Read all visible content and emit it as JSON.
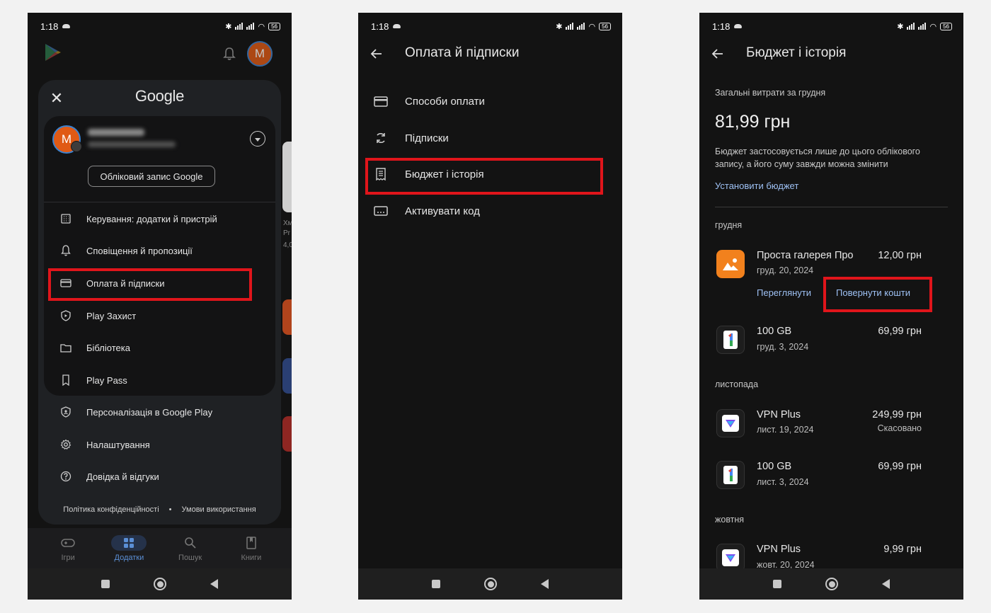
{
  "status": {
    "time": "1:18",
    "battery": "56"
  },
  "screen1": {
    "brand": "Google",
    "account_button": "Обліковий запис Google",
    "avatar_letter": "M",
    "menu": [
      {
        "label": "Керування: додатки й пристрій",
        "icon": "grid-icon"
      },
      {
        "label": "Сповіщення й пропозиції",
        "icon": "bell-icon"
      },
      {
        "label": "Оплата й підписки",
        "icon": "card-icon"
      },
      {
        "label": "Play Захист",
        "icon": "shield-icon"
      },
      {
        "label": "Бібліотека",
        "icon": "folder-icon"
      },
      {
        "label": "Play Pass",
        "icon": "bookmark-icon"
      },
      {
        "label": "Персоналізація в Google Play",
        "icon": "personalize-icon"
      },
      {
        "label": "Налаштування",
        "icon": "gear-icon"
      },
      {
        "label": "Довідка й відгуки",
        "icon": "help-icon"
      }
    ],
    "footer": {
      "privacy": "Політика конфіденційності",
      "dot": "•",
      "terms": "Умови використання"
    },
    "bottom_nav": [
      {
        "label": "Ігри",
        "icon": "gamepad-icon"
      },
      {
        "label": "Додатки",
        "icon": "apps-icon"
      },
      {
        "label": "Пошук",
        "icon": "search-icon"
      },
      {
        "label": "Книги",
        "icon": "book-icon"
      }
    ],
    "background_text": [
      "Хм",
      "Pr",
      "4,0"
    ]
  },
  "screen2": {
    "title": "Оплата й підписки",
    "items": [
      {
        "label": "Способи оплати",
        "icon": "card-icon"
      },
      {
        "label": "Підписки",
        "icon": "refresh-icon"
      },
      {
        "label": "Бюджет і історія",
        "icon": "receipt-icon"
      },
      {
        "label": "Активувати код",
        "icon": "code-icon"
      }
    ]
  },
  "screen3": {
    "title": "Бюджет і історія",
    "total_label": "Загальні витрати за грудня",
    "total_amount": "81,99 грн",
    "budget_note": "Бюджет застосовується лише до цього облікового запису, а його суму завжди можна змінити",
    "set_budget": "Установити бюджет",
    "months": [
      "грудня",
      "листопада",
      "жовтня"
    ],
    "transactions": [
      {
        "name": "Проста галерея Про",
        "date": "груд. 20, 2024",
        "price": "12,00 грн",
        "icon": "gallery-app-icon",
        "view": "Переглянути",
        "refund": "Повернути кошти"
      },
      {
        "name": "100 GB",
        "date": "груд. 3, 2024",
        "price": "69,99 грн",
        "icon": "google-one-icon"
      },
      {
        "name": "VPN Plus",
        "date": "лист. 19, 2024",
        "price": "249,99 грн",
        "status": "Скасовано",
        "icon": "vpn-app-icon"
      },
      {
        "name": "100 GB",
        "date": "лист. 3, 2024",
        "price": "69,99 грн",
        "icon": "google-one-icon"
      },
      {
        "name": "VPN Plus",
        "date": "жовт. 20, 2024",
        "price": "9,99 грн",
        "icon": "vpn-app-icon"
      }
    ]
  },
  "colors": {
    "highlight": "#e0151b",
    "link": "#9ec1f4",
    "background": "#131313",
    "avatar": "#e05a15"
  }
}
